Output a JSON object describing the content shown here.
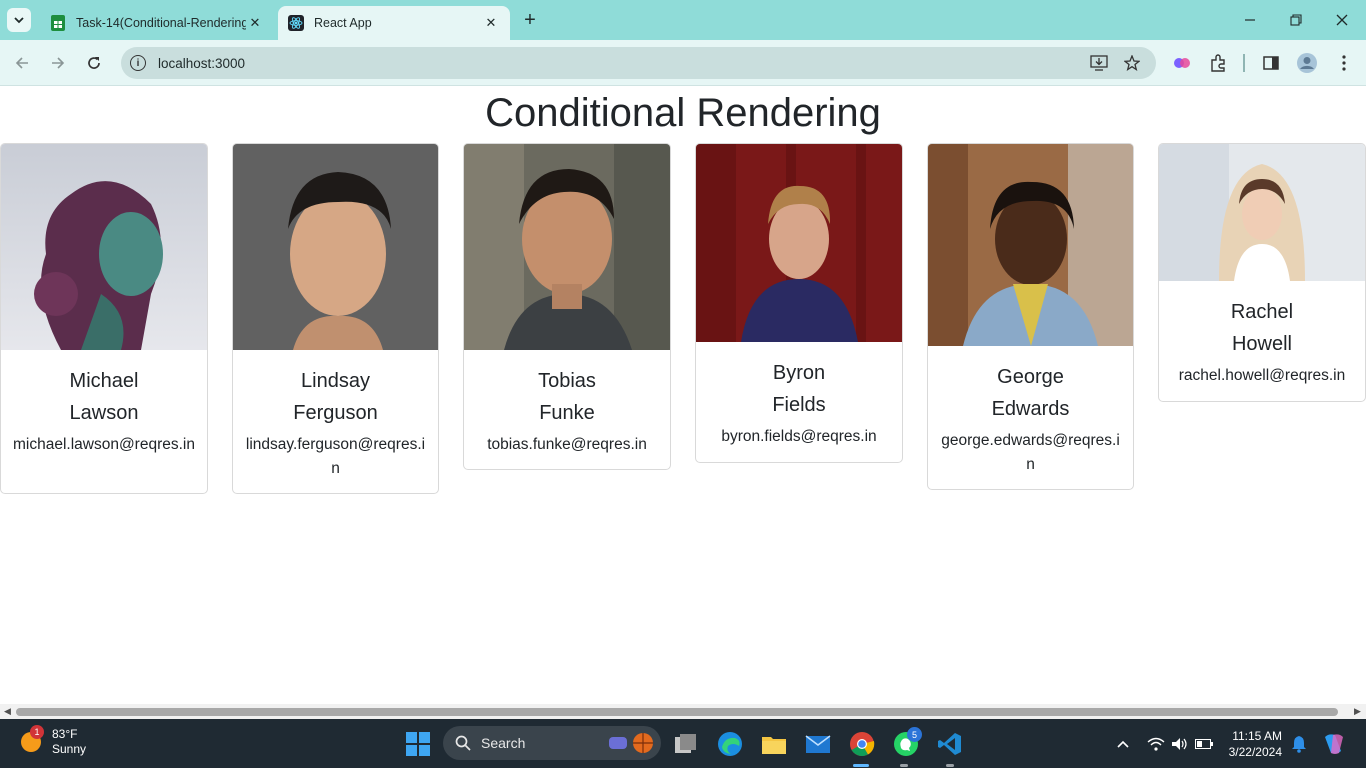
{
  "browser": {
    "tabs": [
      {
        "title": "Task-14(Conditional-Rendering)",
        "active": false,
        "favicon": "google-sheets-icon"
      },
      {
        "title": "React App",
        "active": true,
        "favicon": "react-icon"
      }
    ],
    "url": "localhost:3000"
  },
  "page": {
    "title": "Conditional Rendering",
    "users": [
      {
        "first": "Michael",
        "last": "Lawson",
        "email": "michael.lawson@reqres.in"
      },
      {
        "first": "Lindsay",
        "last": "Ferguson",
        "email": "lindsay.ferguson@reqres.in"
      },
      {
        "first": "Tobias",
        "last": "Funke",
        "email": "tobias.funke@reqres.in"
      },
      {
        "first": "Byron",
        "last": "Fields",
        "email": "byron.fields@reqres.in"
      },
      {
        "first": "George",
        "last": "Edwards",
        "email": "george.edwards@reqres.in"
      },
      {
        "first": "Rachel",
        "last": "Howell",
        "email": "rachel.howell@reqres.in"
      }
    ]
  },
  "taskbar": {
    "weather": {
      "temp": "83°F",
      "condition": "Sunny",
      "badge": "1"
    },
    "search_label": "Search",
    "whatsapp_badge": "5",
    "time": "11:15 AM",
    "date": "3/22/2024"
  },
  "colors": {
    "tabstrip": "#8fdcd8",
    "toolbar": "#e6f6f5",
    "taskbar": "#1f2a33"
  }
}
